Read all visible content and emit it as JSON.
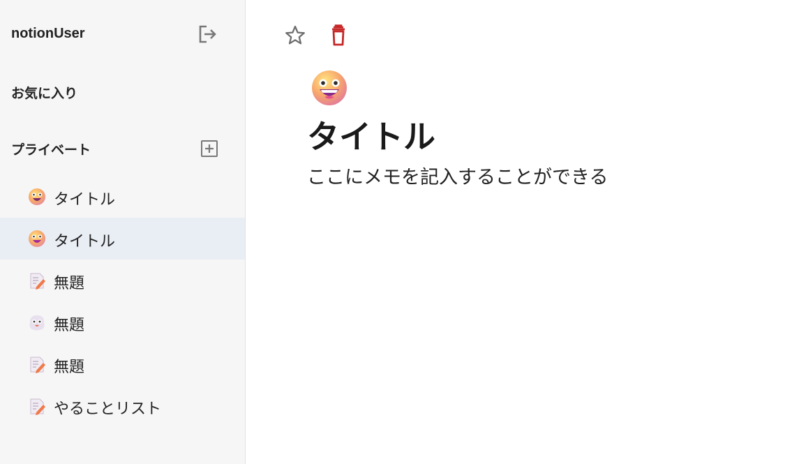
{
  "sidebar": {
    "username": "notionUser",
    "logout_icon": "logout-icon",
    "favorites_title": "お気に入り",
    "private_title": "プライベート",
    "add_icon": "add-box-icon",
    "pages": [
      {
        "label": "タイトル",
        "icon": "grinning-face-emoji",
        "active": false
      },
      {
        "label": "タイトル",
        "icon": "grinning-face-emoji",
        "active": true
      },
      {
        "label": "無題",
        "icon": "memo-emoji",
        "active": false
      },
      {
        "label": "無題",
        "icon": "ghost-face-emoji",
        "active": false
      },
      {
        "label": "無題",
        "icon": "memo-emoji",
        "active": false
      },
      {
        "label": "やることリスト",
        "icon": "memo-emoji",
        "active": false
      }
    ]
  },
  "main": {
    "star_icon": "star-outline-icon",
    "trash_icon": "trash-icon",
    "trash_color": "#c62828",
    "page_emoji": "grinning-face-emoji",
    "title": "タイトル",
    "memo": "ここにメモを記入することができる"
  }
}
